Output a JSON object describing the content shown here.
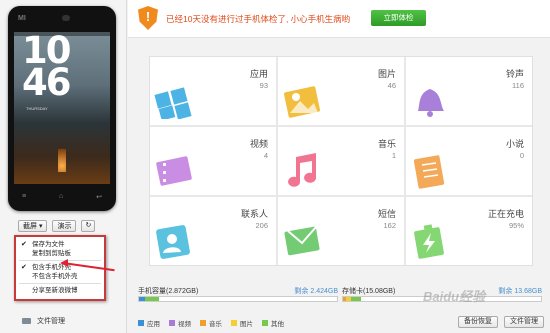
{
  "phone": {
    "brand": "MI",
    "clock_hours": "10",
    "clock_minutes": "46",
    "date_line": "THURSDAY",
    "key_left": "≡",
    "key_mid": "⌂",
    "key_right": "↩"
  },
  "left_controls": {
    "screenshot_label": "截屏 ▾",
    "demo_label": "演示",
    "refresh_icon": "↻"
  },
  "screenshot_menu": {
    "items": [
      {
        "label": "保存为文件",
        "checked": true
      },
      {
        "label": "复制到剪贴板",
        "checked": false
      },
      {
        "label": "包含手机外壳",
        "checked": true
      },
      {
        "label": "不包含手机外壳",
        "checked": false
      },
      {
        "label": "分享至新浪微博",
        "checked": false
      }
    ]
  },
  "sidebar": {
    "file_manager": "文件管理"
  },
  "banner": {
    "warning_icon": "!",
    "message": "已经10天没有进行过手机体检了, 小心手机生病哟",
    "check_button": "立即体检"
  },
  "categories": [
    {
      "label": "应用",
      "count": "93",
      "color": "#2fa5e0",
      "icon": "apps-icon"
    },
    {
      "label": "图片",
      "count": "46",
      "color": "#f0b31c",
      "icon": "image-icon"
    },
    {
      "label": "铃声",
      "count": "116",
      "color": "#9b6ad3",
      "icon": "bell-icon"
    },
    {
      "label": "视频",
      "count": "4",
      "color": "#c07ae0",
      "icon": "video-icon"
    },
    {
      "label": "音乐",
      "count": "1",
      "color": "#ee5c7c",
      "icon": "music-icon"
    },
    {
      "label": "小说",
      "count": "0",
      "color": "#f29b3c",
      "icon": "book-icon"
    },
    {
      "label": "联系人",
      "count": "206",
      "color": "#3eb7d9",
      "icon": "contacts-icon"
    },
    {
      "label": "短信",
      "count": "162",
      "color": "#5bc25b",
      "icon": "sms-icon"
    },
    {
      "label": "正在充电",
      "count": "95%",
      "color": "#6fd15a",
      "icon": "battery-icon"
    }
  ],
  "storage": {
    "phone": {
      "label": "手机容量(2.872GB)",
      "free": "剩余 2.424GB",
      "used_fraction": 0.16
    },
    "sd": {
      "label": "存储卡(15.08GB)",
      "free": "剩余 13.68GB",
      "used_fraction": 0.09
    }
  },
  "legend": [
    {
      "label": "应用",
      "color": "#3d8fd6"
    },
    {
      "label": "视频",
      "color": "#a97ad6"
    },
    {
      "label": "音乐",
      "color": "#f0a030"
    },
    {
      "label": "图片",
      "color": "#f2d030"
    },
    {
      "label": "其他",
      "color": "#78c850"
    }
  ],
  "bottom_buttons": {
    "backup": "备份恢复",
    "files": "文件管理"
  },
  "watermark": "Baidu经验"
}
